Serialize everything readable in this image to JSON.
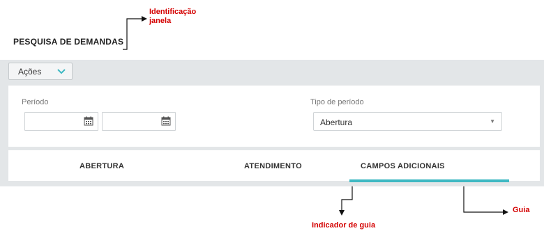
{
  "header": {
    "title": "PESQUISA DE DEMANDAS"
  },
  "toolbar": {
    "actions_label": "Ações",
    "actions_icon": "chevron-down-icon"
  },
  "filters": {
    "period_label": "Período",
    "period_type_label": "Tipo de período",
    "period_type_value": "Abertura",
    "date_start_value": "",
    "date_end_value": ""
  },
  "tabs": [
    {
      "label": "ABERTURA",
      "active": false
    },
    {
      "label": "ATENDIMENTO",
      "active": false
    },
    {
      "label": "CAMPOS ADICIONAIS",
      "active": true
    }
  ],
  "annotations": {
    "window_id": "Identificação janela",
    "tab": "Guia",
    "tab_indicator": "Indicador de guia"
  },
  "colors": {
    "accent": "#3fb9c3",
    "annotation": "#d40000",
    "panel_bg": "#e3e6e8"
  }
}
